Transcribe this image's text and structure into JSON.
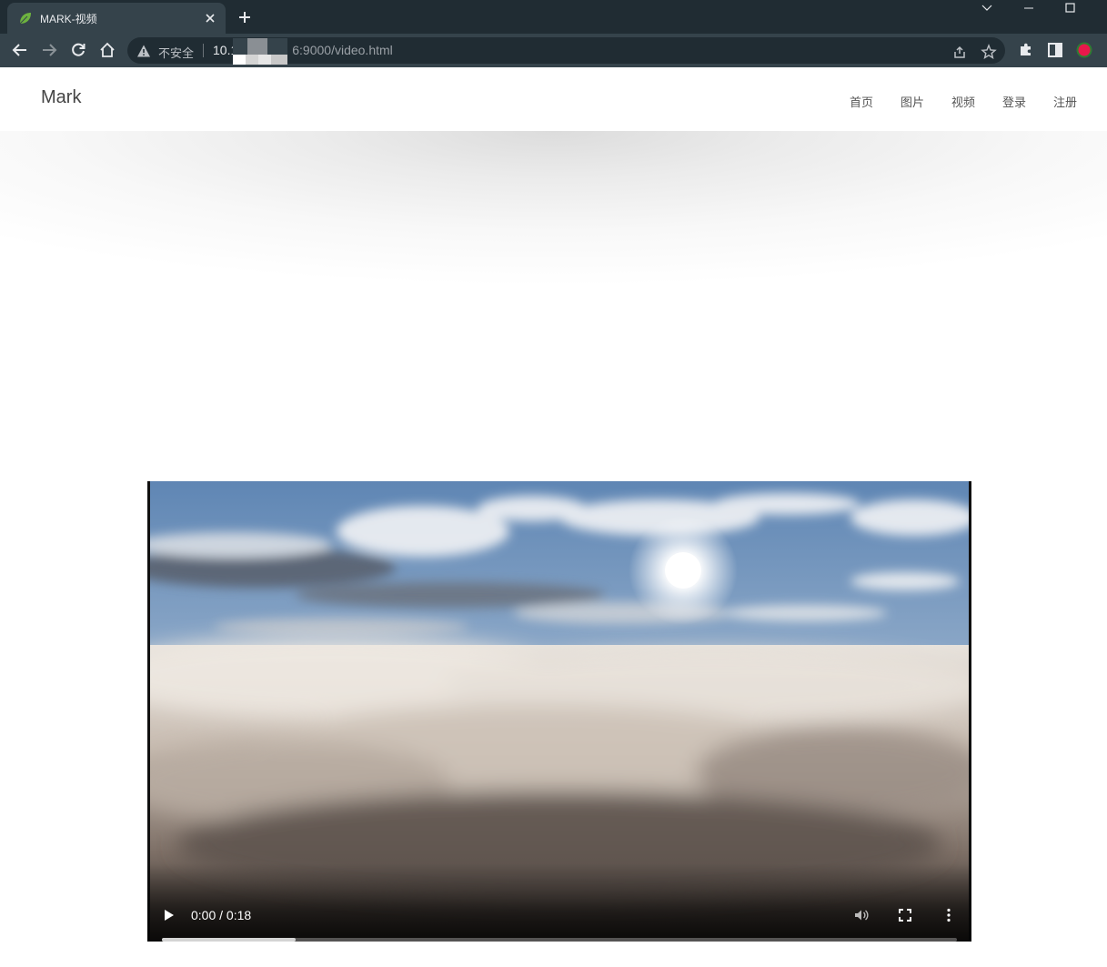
{
  "browser": {
    "tab_title": "MARK-视频",
    "security_label": "不安全",
    "url_prefix": "10.1",
    "url_suffix": "6:9000/video.html",
    "colors": {
      "frame": "#202c33",
      "toolbar": "#35434b",
      "profile": "#e8184b"
    }
  },
  "site": {
    "brand": "Mark",
    "nav": [
      {
        "label": "首页"
      },
      {
        "label": "图片"
      },
      {
        "label": "视频"
      },
      {
        "label": "登录"
      },
      {
        "label": "注册"
      }
    ]
  },
  "video": {
    "time_display": "0:00 / 0:18",
    "buffered_fraction": 0.168,
    "scene": "aerial view above clouds with sun"
  }
}
